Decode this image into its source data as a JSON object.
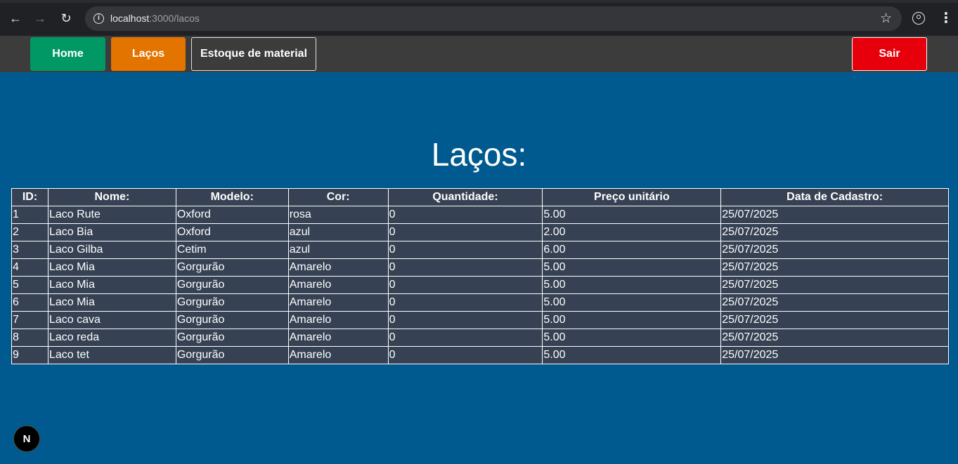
{
  "browser": {
    "url_host": "localhost",
    "url_path": ":3000/lacos"
  },
  "navbar": {
    "home_label": "Home",
    "lacos_label": "Laços",
    "estoque_label": "Estoque de material",
    "sair_label": "Sair"
  },
  "page": {
    "title": "Laços:"
  },
  "table": {
    "headers": [
      "ID:",
      "Nome:",
      "Modelo:",
      "Cor:",
      "Quantidade:",
      "Preço unitário",
      "Data de Cadastro:"
    ],
    "rows": [
      [
        "1",
        "Laco Rute",
        "Oxford",
        "rosa",
        "0",
        "5.00",
        "25/07/2025"
      ],
      [
        "2",
        "Laco Bia",
        "Oxford",
        "azul",
        "0",
        "2.00",
        "25/07/2025"
      ],
      [
        "3",
        "Laco Gilba",
        "Cetim",
        "azul",
        "0",
        "6.00",
        "25/07/2025"
      ],
      [
        "4",
        "Laco Mia",
        "Gorgurão",
        "Amarelo",
        "0",
        "5.00",
        "25/07/2025"
      ],
      [
        "5",
        "Laco Mia",
        "Gorgurão",
        "Amarelo",
        "0",
        "5.00",
        "25/07/2025"
      ],
      [
        "6",
        "Laco Mia",
        "Gorgurão",
        "Amarelo",
        "0",
        "5.00",
        "25/07/2025"
      ],
      [
        "7",
        "Laco cava",
        "Gorgurão",
        "Amarelo",
        "0",
        "5.00",
        "25/07/2025"
      ],
      [
        "8",
        "Laco reda",
        "Gorgurão",
        "Amarelo",
        "0",
        "5.00",
        "25/07/2025"
      ],
      [
        "9",
        "Laco tet",
        "Gorgurão",
        "Amarelo",
        "0",
        "5.00",
        "25/07/2025"
      ]
    ]
  },
  "dev_badge": {
    "label": "N"
  },
  "colors": {
    "page_bg": "#005a8f",
    "navbar_bg": "#3c3c3c",
    "home_button": "#009966",
    "lacos_button": "#e37400",
    "sair_button": "#e7000b",
    "table_bg": "#364153"
  },
  "icons": {
    "back": "arrow-left-icon",
    "forward": "arrow-right-icon",
    "reload": "reload-icon",
    "site_info": "info-icon",
    "bookmark": "star-icon",
    "profile": "profile-icon",
    "menu": "kebab-menu-icon"
  }
}
